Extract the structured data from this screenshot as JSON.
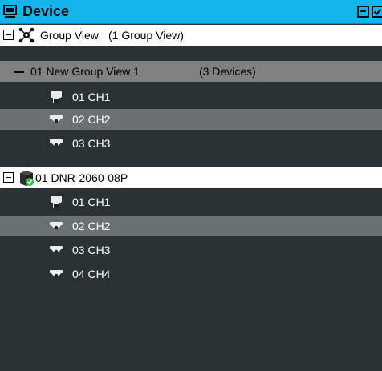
{
  "header": {
    "title": "Device",
    "icon": "monitor-icon",
    "collapse_icon": "collapse-all-icon",
    "check_icon": "check-box-icon"
  },
  "tree": {
    "group_view_root": {
      "label": "Group View",
      "suffix": "(1 Group View)",
      "icon": "group-network-icon"
    },
    "group": {
      "label": "01 New Group View 1",
      "suffix": "(3 Devices)"
    },
    "group_channels": [
      {
        "label": "01 CH1",
        "icon": "box-camera-icon"
      },
      {
        "label": "02 CH2",
        "icon": "dome-camera-icon"
      },
      {
        "label": "03 CH3",
        "icon": "dome-camera-icon"
      }
    ],
    "device": {
      "label": "01 DNR-2060-08P",
      "icon": "nvr-online-icon"
    },
    "device_channels": [
      {
        "label": "01 CH1",
        "icon": "box-camera-icon"
      },
      {
        "label": "02 CH2",
        "icon": "dome-camera-icon"
      },
      {
        "label": "03 CH3",
        "icon": "dome-camera-icon"
      },
      {
        "label": "04 CH4",
        "icon": "dome-camera-icon"
      }
    ]
  },
  "colors": {
    "header_bg": "#14b4ec",
    "panel_bg": "#2b3236",
    "group_row_bg": "#818181",
    "selected_row_bg": "#6a7073",
    "online_badge": "#37b34a"
  }
}
